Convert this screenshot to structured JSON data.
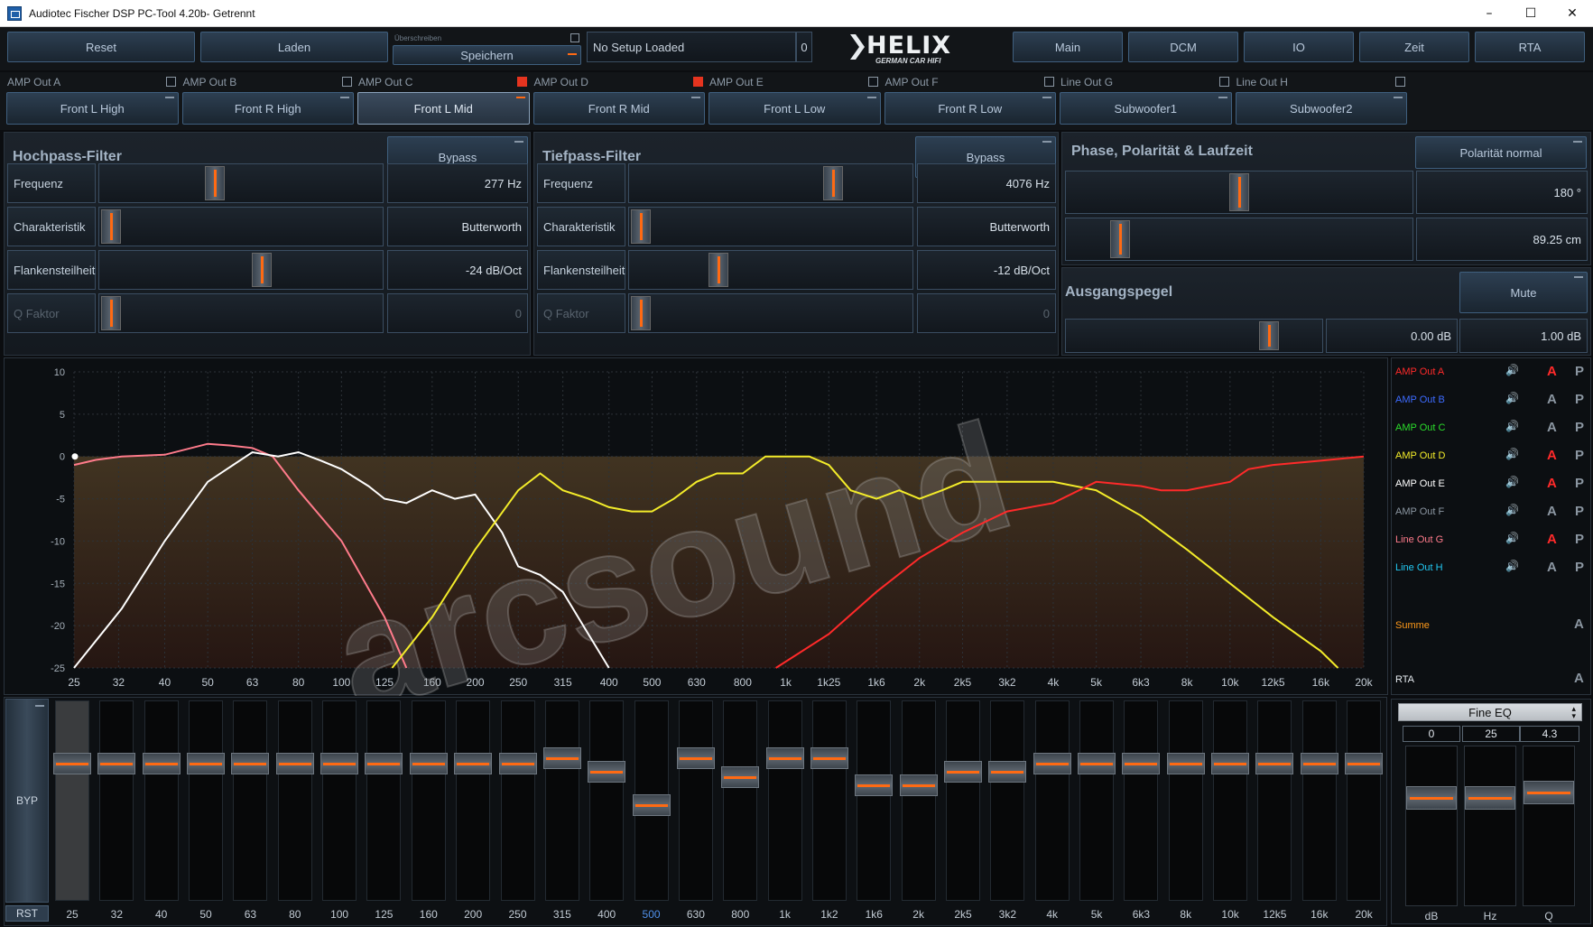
{
  "window": {
    "title": "Audiotec Fischer DSP PC-Tool 4.20b- Getrennt",
    "minimize": "–",
    "maximize": "☐",
    "close": "✕"
  },
  "toolbar": {
    "reset": "Reset",
    "load": "Laden",
    "overwrite": "Überschreiben",
    "save": "Speichern",
    "setup_name": "No Setup Loaded",
    "setup_number": "0",
    "logo_text": "HELIX",
    "logo_sub": "GERMAN CAR HIFI",
    "nav": [
      "Main",
      "DCM",
      "IO",
      "Zeit",
      "RTA"
    ]
  },
  "channels": [
    {
      "label": "AMP Out A",
      "name": "Front L High",
      "checked": false,
      "active": false
    },
    {
      "label": "AMP Out B",
      "name": "Front R High",
      "checked": false,
      "active": false
    },
    {
      "label": "AMP Out C",
      "name": "Front L Mid",
      "checked": true,
      "active": true
    },
    {
      "label": "AMP Out D",
      "name": "Front R Mid",
      "checked": true,
      "active": false
    },
    {
      "label": "AMP Out E",
      "name": "Front L Low",
      "checked": false,
      "active": false
    },
    {
      "label": "AMP Out F",
      "name": "Front R Low",
      "checked": false,
      "active": false
    },
    {
      "label": "Line Out G",
      "name": "Subwoofer1",
      "checked": false,
      "active": false
    },
    {
      "label": "Line Out H",
      "name": "Subwoofer2",
      "checked": false,
      "active": false
    }
  ],
  "highpass": {
    "title": "Hochpass-Filter",
    "bypass": "Bypass",
    "rows": [
      {
        "label": "Frequenz",
        "value": "277 Hz",
        "pos": 0.4,
        "dim": false
      },
      {
        "label": "Charakteristik",
        "value": "Butterworth",
        "pos": 0.0,
        "dim": false
      },
      {
        "label": "Flankensteilheit",
        "value": "-24 dB/Oct",
        "pos": 0.58,
        "dim": false
      },
      {
        "label": "Q Faktor",
        "value": "0",
        "pos": 0.0,
        "dim": true
      }
    ]
  },
  "lowpass": {
    "title": "Tiefpass-Filter",
    "bypass": "Bypass",
    "rows": [
      {
        "label": "Frequenz",
        "value": "4076 Hz",
        "pos": 0.74,
        "dim": false
      },
      {
        "label": "Charakteristik",
        "value": "Butterworth",
        "pos": 0.0,
        "dim": false
      },
      {
        "label": "Flankensteilheit",
        "value": "-12 dB/Oct",
        "pos": 0.3,
        "dim": false
      },
      {
        "label": "Q Faktor",
        "value": "0",
        "pos": 0.0,
        "dim": true
      }
    ]
  },
  "phase": {
    "title": "Phase, Polarität & Laufzeit",
    "polarity": "Polarität normal",
    "phase_value": "180 °",
    "phase_pos": 0.5,
    "delay_value": "89.25 cm",
    "delay_pos": 0.13
  },
  "output": {
    "title": "Ausgangspegel",
    "mute": "Mute",
    "level_value": "0.00 dB",
    "factor_value": "1.00 dB",
    "pos": 0.82
  },
  "graph": {
    "y_ticks": [
      "10",
      "5",
      "0",
      "-5",
      "-10",
      "-15",
      "-20",
      "-25"
    ],
    "x_ticks": [
      "25",
      "32",
      "40",
      "50",
      "63",
      "80",
      "100",
      "125",
      "160",
      "200",
      "250",
      "315",
      "400",
      "500",
      "630",
      "800",
      "1k",
      "1k25",
      "1k6",
      "2k",
      "2k5",
      "3k2",
      "4k",
      "5k",
      "6k3",
      "8k",
      "10k",
      "12k5",
      "16k",
      "20k"
    ],
    "watermark": "arcsound"
  },
  "legend": {
    "rows": [
      {
        "name": "AMP Out A",
        "color": "#ff2a2a",
        "a_color": "#ff2a2a",
        "p": "P"
      },
      {
        "name": "AMP Out B",
        "color": "#3d6bff",
        "a_color": "#8b96a1",
        "p": "P"
      },
      {
        "name": "AMP Out C",
        "color": "#2bdc2b",
        "a_color": "#8b96a1",
        "p": "P"
      },
      {
        "name": "AMP Out D",
        "color": "#f3ec2a",
        "a_color": "#ff2a2a",
        "p": "P"
      },
      {
        "name": "AMP Out E",
        "color": "#ffffff",
        "a_color": "#ff2a2a",
        "p": "P"
      },
      {
        "name": "AMP Out F",
        "color": "#8b96a1",
        "a_color": "#8b96a1",
        "p": "P"
      },
      {
        "name": "Line Out G",
        "color": "#ff7b8b",
        "a_color": "#ff2a2a",
        "p": "P"
      },
      {
        "name": "Line Out H",
        "color": "#22c8f2",
        "a_color": "#8b96a1",
        "p": "P"
      }
    ],
    "sum": "Summe",
    "rta": "RTA",
    "a": "A",
    "speaker_icon": "🔊"
  },
  "eq": {
    "byp": "BYP",
    "rst": "RST",
    "bands": [
      {
        "label": "25",
        "gain": 0
      },
      {
        "label": "32",
        "gain": 0
      },
      {
        "label": "40",
        "gain": 0
      },
      {
        "label": "50",
        "gain": 0
      },
      {
        "label": "63",
        "gain": 0
      },
      {
        "label": "80",
        "gain": 0
      },
      {
        "label": "100",
        "gain": 0
      },
      {
        "label": "125",
        "gain": 0
      },
      {
        "label": "160",
        "gain": 0
      },
      {
        "label": "200",
        "gain": 0
      },
      {
        "label": "250",
        "gain": 0
      },
      {
        "label": "315",
        "gain": 1
      },
      {
        "label": "400",
        "gain": -1.5
      },
      {
        "label": "500",
        "gain": -7.5
      },
      {
        "label": "630",
        "gain": 1
      },
      {
        "label": "800",
        "gain": -2.5
      },
      {
        "label": "1k",
        "gain": 1
      },
      {
        "label": "1k2",
        "gain": 1
      },
      {
        "label": "1k6",
        "gain": -4
      },
      {
        "label": "2k",
        "gain": -4
      },
      {
        "label": "2k5",
        "gain": -1.5
      },
      {
        "label": "3k2",
        "gain": -1.5
      },
      {
        "label": "4k",
        "gain": 0
      },
      {
        "label": "5k",
        "gain": 0
      },
      {
        "label": "6k3",
        "gain": 0
      },
      {
        "label": "8k",
        "gain": 0
      },
      {
        "label": "10k",
        "gain": 0
      },
      {
        "label": "12k5",
        "gain": 0
      },
      {
        "label": "16k",
        "gain": 0
      },
      {
        "label": "20k",
        "gain": 0
      }
    ],
    "selected_index": 0,
    "highlight_index": 13
  },
  "fine_eq": {
    "mode": "Fine EQ",
    "values": [
      "0",
      "25",
      "4.3"
    ],
    "labels": [
      "dB",
      "Hz",
      "Q"
    ]
  }
}
